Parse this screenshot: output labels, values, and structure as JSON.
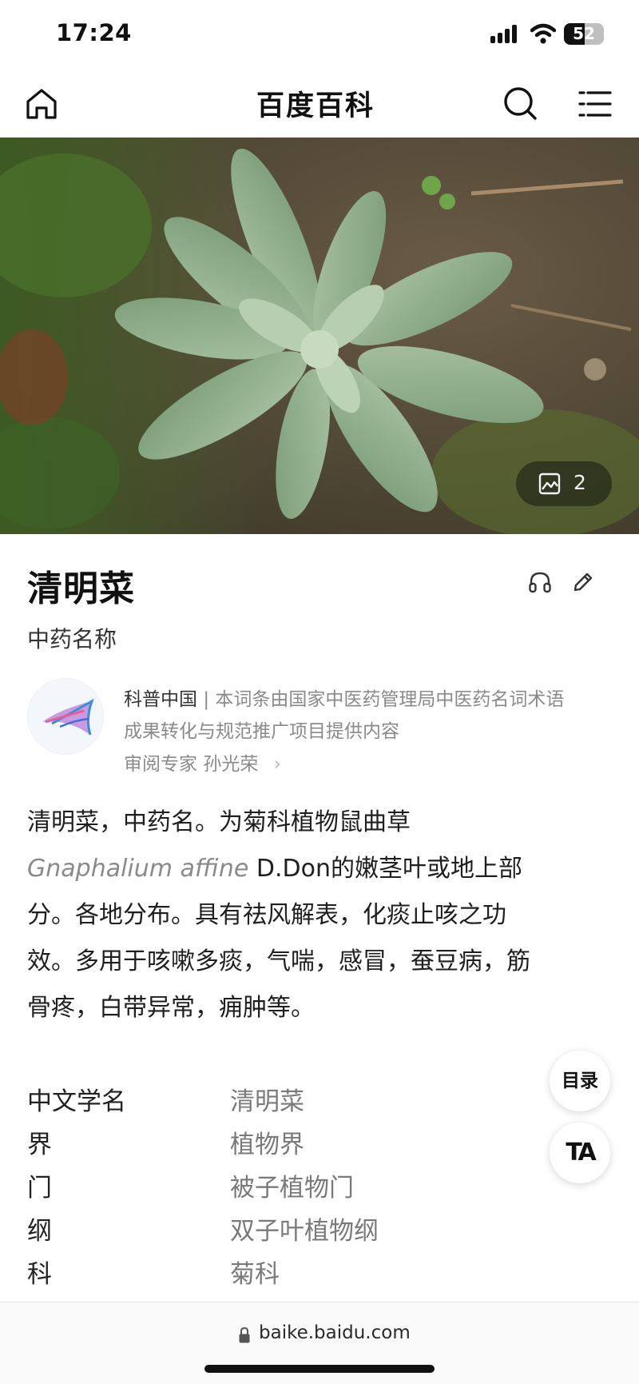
{
  "status_bar": {
    "time": "17:24",
    "battery_level": "52"
  },
  "nav": {
    "title": "百度百科",
    "home_icon": "home-icon",
    "search_icon": "search-icon",
    "menu_icon": "menu-icon"
  },
  "hero": {
    "photo_count": "2",
    "gallery_icon": "gallery-icon"
  },
  "entry": {
    "title": "清明菜",
    "subtitle": "中药名称",
    "listen_icon": "headphones-icon",
    "edit_icon": "pencil-icon"
  },
  "source": {
    "name": "科普中国",
    "separator": "|",
    "line1_text": "本词条由国家中医药管理局中医药名词术语",
    "line2_text": "成果转化与规范推广项目提供内容",
    "reviewer_label": "审阅专家",
    "reviewer_name": "孙光荣",
    "reviewer_arrow": "›"
  },
  "summary": {
    "line1": "清明菜，中药名。为菊科植物鼠曲草",
    "latin": "Gnaphalium affine",
    "line2_rest": " D.Don的嫩茎叶或地上部",
    "line3": "分。各地分布。具有祛风解表，化痰止咳之功",
    "line4": "效。多用于咳嗽多痰，气喘，感冒，蚕豆病，筋",
    "line5": "骨疼，白带异常，痈肿等。"
  },
  "info_table": [
    {
      "label": "中文学名",
      "value": "清明菜"
    },
    {
      "label": "界",
      "value": "植物界"
    },
    {
      "label": "门",
      "value": "被子植物门"
    },
    {
      "label": "纲",
      "value": "双子叶植物纲"
    },
    {
      "label": "科",
      "value": "菊科"
    }
  ],
  "float_buttons": {
    "toc": "目录",
    "ta": "TA"
  },
  "browser": {
    "url": "baike.baidu.com",
    "lock_icon": "lock-icon"
  },
  "colors": {
    "text": "#1f1f1f",
    "muted": "#8a8a8a",
    "value_gray": "#7a7a7a",
    "leaf_green": "#8fb08a"
  }
}
